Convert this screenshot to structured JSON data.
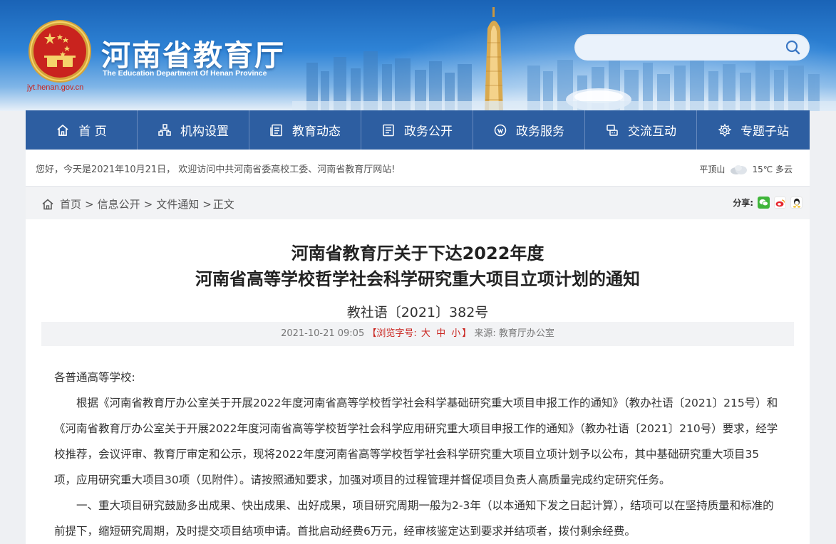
{
  "header": {
    "site_title": "河南省教育厅",
    "site_subtitle": "The Education Department Of Henan Province",
    "domain": "jyt.henan.gov.cn",
    "search_placeholder": ""
  },
  "nav": {
    "items": [
      {
        "label": "首 页",
        "icon": "home-icon"
      },
      {
        "label": "机构设置",
        "icon": "org-icon"
      },
      {
        "label": "教育动态",
        "icon": "news-icon"
      },
      {
        "label": "政务公开",
        "icon": "gov-open-icon"
      },
      {
        "label": "政务服务",
        "icon": "service-icon"
      },
      {
        "label": "交流互动",
        "icon": "interact-icon"
      },
      {
        "label": "专题子站",
        "icon": "topic-icon"
      }
    ]
  },
  "welcome": {
    "text": "您好，今天是2021年10月21日， 欢迎访问中共河南省委高校工委、河南省教育厅网站!",
    "weather_city": "平顶山",
    "weather_desc": "15℃ 多云"
  },
  "breadcrumb": {
    "items": [
      "首页",
      "信息公开",
      "文件通知"
    ],
    "current": "正文",
    "share_label": "分享:"
  },
  "article": {
    "title_line1": "河南省教育厅关于下达2022年度",
    "title_line2": "河南省高等学校哲学社会科学研究重大项目立项计划的通知",
    "doc_number": "教社语〔2021〕382号",
    "date": "2021-10-21 09:05",
    "font_size_label": "【浏览字号:",
    "font_size_large": "大",
    "font_size_medium": "中",
    "font_size_small": "小",
    "font_size_end": "】",
    "source": "来源: 教育厅办公室",
    "salutation": "各普通高等学校:",
    "para1": "根据《河南省教育厅办公室关于开展2022年度河南省高等学校哲学社会科学基础研究重大项目申报工作的通知》（教办社语〔2021〕215号）和《河南省教育厅办公室关于开展2022年度河南省高等学校哲学社会科学应用研究重大项目申报工作的通知》（教办社语〔2021〕210号）要求，经学校推荐，会议评审、教育厅审定和公示，现将2022年度河南省高等学校哲学社会科学研究重大项目立项计划予以公布，其中基础研究重大项目35项，应用研究重大项目30项（见附件）。请按照通知要求，加强对项目的过程管理并督促项目负责人高质量完成约定研究任务。",
    "para2": "一、重大项目研究鼓励多出成果、快出成果、出好成果，项目研究周期一般为2-3年（以本通知下发之日起计算），结项可以在坚持质量和标准的前提下，缩短研究周期，及时提交项目结项申请。首批启动经费6万元，经审核鉴定达到要求并结项者，拨付剩余经费。"
  },
  "colors": {
    "nav_bg": "#2d5ea1",
    "accent_red": "#c9231e",
    "banner_blue": "#2e83d6"
  }
}
